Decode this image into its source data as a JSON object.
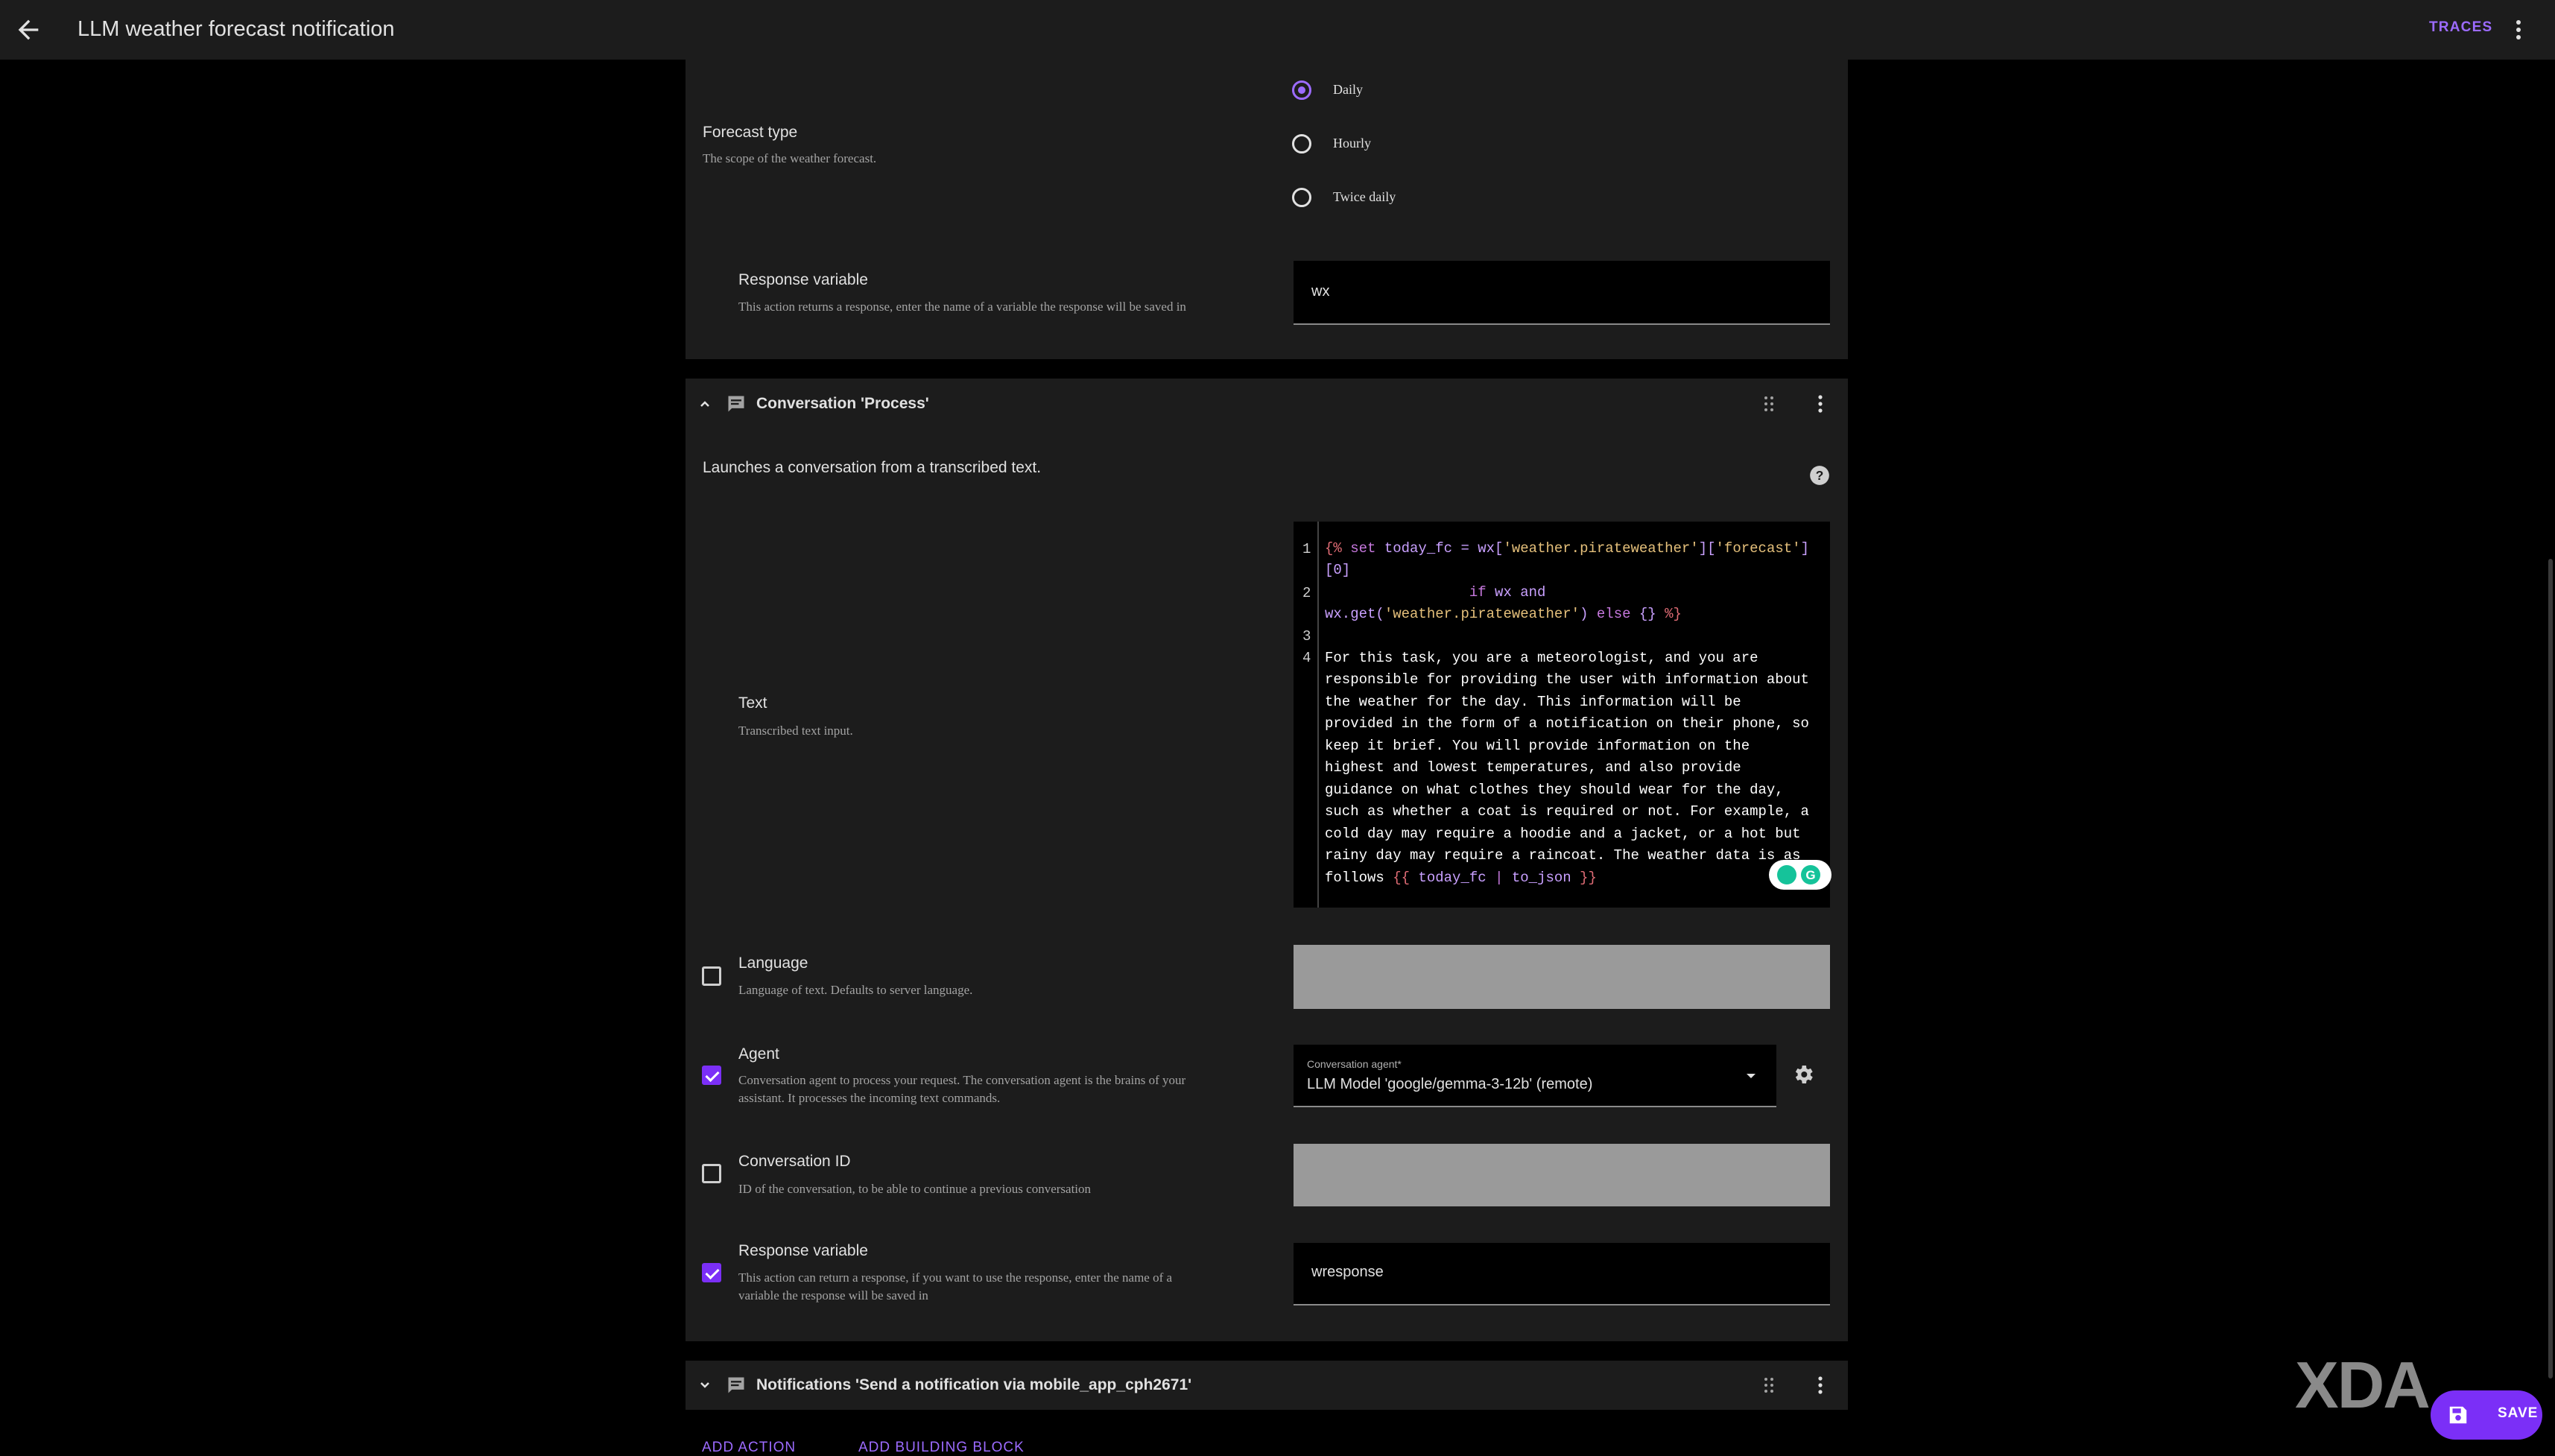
{
  "header": {
    "title": "LLM weather forecast notification",
    "traces_label": "TRACES"
  },
  "forecast": {
    "label": "Forecast type",
    "description": "The scope of the weather forecast.",
    "options": [
      {
        "label": "Daily",
        "selected": true
      },
      {
        "label": "Hourly",
        "selected": false
      },
      {
        "label": "Twice daily",
        "selected": false
      }
    ]
  },
  "response1": {
    "label": "Response variable",
    "description": "This action returns a response, enter the name of a variable the response will be saved in",
    "value": "wx"
  },
  "conversation": {
    "title": "Conversation 'Process'",
    "description": "Launches a conversation from a transcribed text.",
    "text_label": "Text",
    "text_description": "Transcribed text input.",
    "code_line_numbers": [
      "1",
      "2",
      "3",
      "4"
    ],
    "language_label": "Language",
    "language_description": "Language of text. Defaults to server language.",
    "agent_label": "Agent",
    "agent_description_1": "Conversation agent to process your request. The conversation agent is the brains of your",
    "agent_description_2": "assistant. It processes the incoming text commands.",
    "agent_field_label": "Conversation agent*",
    "agent_field_value": "LLM Model 'google/gemma-3-12b' (remote)",
    "conv_id_label": "Conversation ID",
    "conv_id_description": "ID of the conversation, to be able to continue a previous conversation",
    "response_label": "Response variable",
    "response_description_1": "This action can return a response, if you want to use the response, enter the name of a",
    "response_description_2": "variable the response will be saved in",
    "response_value": "wresponse"
  },
  "code": {
    "l1a": "{%",
    "l1b": " set ",
    "l1c": "today_fc = wx[",
    "l1d": "'weather.pirateweather'",
    "l1e": "][",
    "l1f": "'forecast'",
    "l1g": "]",
    "l1h": "[0]",
    "l2a": "                 if ",
    "l2b": "wx and",
    "l2c": "wx.get(",
    "l2d": "'weather.pirateweather'",
    "l2e": ") ",
    "l2f": "else",
    "l2g": " {} ",
    "l2h": "%}",
    "p1": "For this task, you are a meteorologist, and you are",
    "p2": "responsible for providing the user with information about",
    "p3": "the weather for the day. This information will be",
    "p4": "provided in the form of a notification on their phone, so",
    "p5": "keep it brief. You will provide information on the",
    "p6": "highest and lowest temperatures, and also provide",
    "p7": "guidance on what clothes they should wear for the day,",
    "p8": "such as whether a coat is required or not. For example, a",
    "p9": "cold day may require a hoodie and a jacket, or a hot but",
    "p10": "rainy day may require a raincoat. The weather data is as",
    "p11a": "follows ",
    "p11b": "{{",
    "p11c": " today_fc ",
    "p11d": "|",
    "p11e": " to_json ",
    "p11f": "}}"
  },
  "notifications": {
    "title": "Notifications 'Send a notification via mobile_app_cph2671'"
  },
  "footer": {
    "add_action": "ADD ACTION",
    "add_building_block": "ADD BUILDING BLOCK",
    "save_label": "SAVE",
    "watermark": "XDA"
  },
  "colors": {
    "accent": "#7b2ff7",
    "surface": "#1c1c1c",
    "background": "#000000"
  }
}
